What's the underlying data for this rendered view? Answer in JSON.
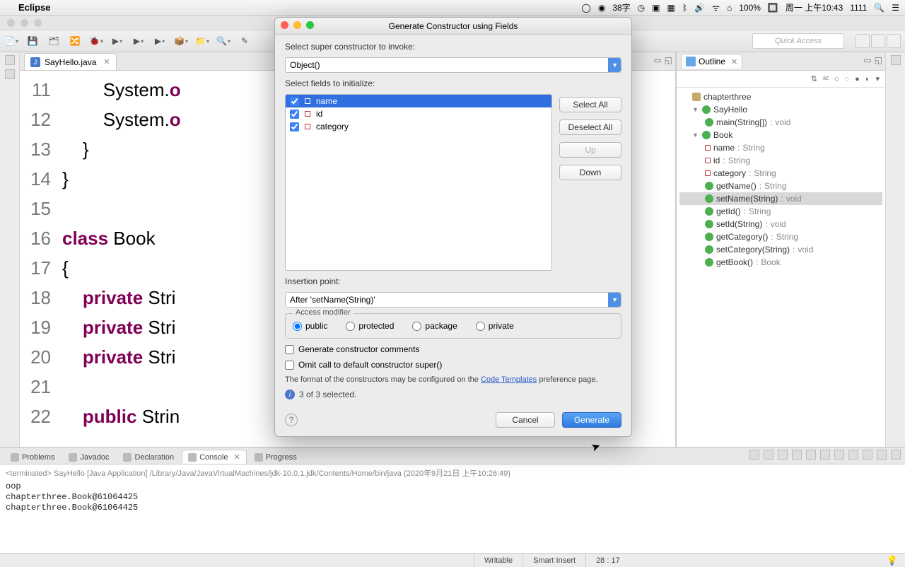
{
  "menubar": {
    "app": "Eclipse",
    "ime": "38字",
    "battery": "100%",
    "clock": "周一 上午10:43",
    "user": "1111"
  },
  "toolbar": {
    "quick_access": "Quick Access"
  },
  "editor": {
    "tab": "SayHello.java",
    "lines": [
      "11",
      "12",
      "13",
      "14",
      "15",
      "16",
      "17",
      "18",
      "19",
      "20",
      "21",
      "22"
    ]
  },
  "outline": {
    "title": "Outline",
    "pkg": "chapterthree",
    "cls1": "SayHello",
    "m_main": "main(String[])",
    "m_main_t": "void",
    "cls2": "Book",
    "f_name": "name",
    "f_name_t": "String",
    "f_id": "id",
    "f_id_t": "String",
    "f_cat": "category",
    "f_cat_t": "String",
    "m_getName": "getName()",
    "m_getName_t": "String",
    "m_setName": "setName(String)",
    "m_setName_t": "void",
    "m_getId": "getId()",
    "m_getId_t": "String",
    "m_setId": "setId(String)",
    "m_setId_t": "void",
    "m_getCat": "getCategory()",
    "m_getCat_t": "String",
    "m_setCat": "setCategory(String)",
    "m_setCat_t": "void",
    "m_getBook": "getBook()",
    "m_getBook_t": "Book"
  },
  "bottom": {
    "tabs": {
      "problems": "Problems",
      "javadoc": "Javadoc",
      "declaration": "Declaration",
      "console": "Console",
      "progress": "Progress"
    },
    "console_header": "<terminated> SayHello [Java Application] /Library/Java/JavaVirtualMachines/jdk-10.0.1.jdk/Contents/Home/bin/java (2020年9月21日 上午10:26:49)",
    "console_body": "oop\nchapterthree.Book@61064425\nchapterthree.Book@61064425"
  },
  "status": {
    "writable": "Writable",
    "insert": "Smart Insert",
    "pos": "28 : 17"
  },
  "dialog": {
    "title": "Generate Constructor using Fields",
    "l_super": "Select super constructor to invoke:",
    "super_val": "Object()",
    "l_fields": "Select fields to initialize:",
    "fields": {
      "f1": "name",
      "f2": "id",
      "f3": "category"
    },
    "b_selall": "Select All",
    "b_deselall": "Deselect All",
    "b_up": "Up",
    "b_down": "Down",
    "l_insert": "Insertion point:",
    "insert_val": "After 'setName(String)'",
    "l_access": "Access modifier",
    "r_public": "public",
    "r_protected": "protected",
    "r_package": "package",
    "r_private": "private",
    "c_comments": "Generate constructor comments",
    "c_omit": "Omit call to default constructor super()",
    "note_pre": "The format of the constructors may be configured on the ",
    "note_link": "Code Templates",
    "note_post": " preference page.",
    "selcount": "3 of 3 selected.",
    "b_cancel": "Cancel",
    "b_generate": "Generate"
  },
  "chart_data": null
}
